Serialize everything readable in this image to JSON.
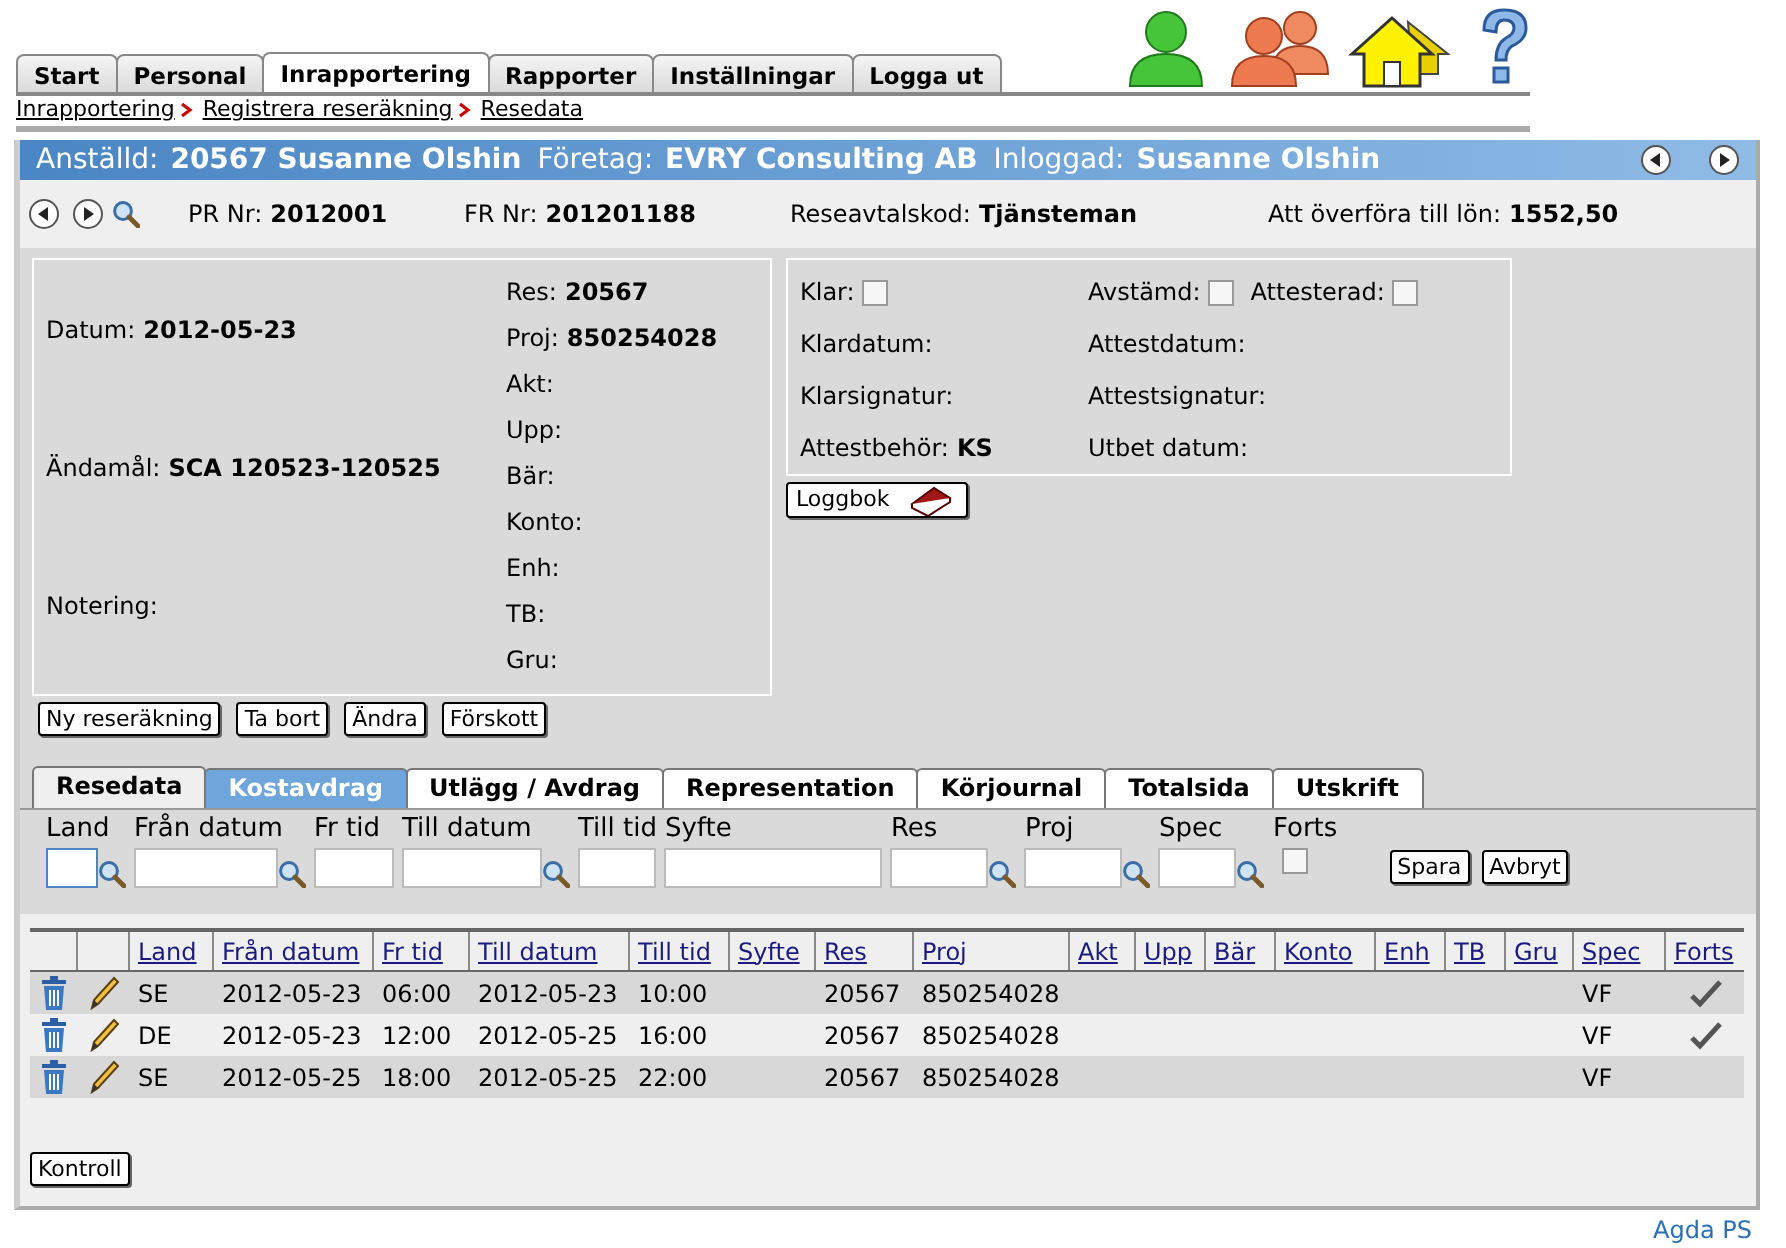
{
  "nav_tabs": [
    {
      "label": "Start",
      "selected": false
    },
    {
      "label": "Personal",
      "selected": false
    },
    {
      "label": "Inrapportering",
      "selected": true
    },
    {
      "label": "Rapporter",
      "selected": false
    },
    {
      "label": "Inställningar",
      "selected": false
    },
    {
      "label": "Logga ut",
      "selected": false
    }
  ],
  "breadcrumb": [
    "Inrapportering",
    "Registrera reseräkning",
    "Resedata"
  ],
  "header": {
    "employee_label": "Anställd:",
    "employee": "20567 Susanne Olshin",
    "company_label": "Företag:",
    "company": "EVRY Consulting AB",
    "login_label": "Inloggad:",
    "login": "Susanne Olshin"
  },
  "info": [
    {
      "label": "PR Nr:",
      "value": "2012001"
    },
    {
      "label": "FR Nr:",
      "value": "201201188"
    },
    {
      "label": "Reseavtalskod:",
      "value": "Tjänsteman"
    },
    {
      "label": "Att överföra till lön:",
      "value": "1552,50"
    }
  ],
  "travel": [
    {
      "label": "Datum:",
      "value": "2012-05-23"
    },
    {
      "label": "Ändamål:",
      "value": "SCA 120523-120525"
    },
    {
      "label": "Notering:"
    }
  ],
  "coding": [
    {
      "label": "Res:",
      "value": "20567"
    },
    {
      "label": "Proj:",
      "value": "850254028"
    },
    {
      "label": "Akt:"
    },
    {
      "label": "Upp:"
    },
    {
      "label": "Bär:"
    },
    {
      "label": "Konto:"
    },
    {
      "label": "Enh:"
    },
    {
      "label": "TB:"
    },
    {
      "label": "Gru:"
    }
  ],
  "approval_rows": [
    {
      "left": [
        {
          "kind": "checkbox",
          "label": "Klar:",
          "checked": false
        }
      ],
      "right": [
        {
          "kind": "checkbox",
          "label": "Avstämd:",
          "checked": false
        },
        {
          "kind": "checkbox",
          "label": "Attesterad:",
          "checked": false
        }
      ]
    },
    {
      "left": [
        {
          "kind": "field",
          "label": "Klardatum:"
        }
      ],
      "right": [
        {
          "kind": "field",
          "label": "Attestdatum:"
        }
      ]
    },
    {
      "left": [
        {
          "kind": "field",
          "label": "Klarsignatur:"
        }
      ],
      "right": [
        {
          "kind": "field",
          "label": "Attestsignatur:"
        }
      ]
    },
    {
      "left": [
        {
          "kind": "field",
          "label": "Attestbehör:",
          "value": "KS"
        }
      ],
      "right": [
        {
          "kind": "field",
          "label": "Utbet datum:"
        }
      ]
    }
  ],
  "logbook_button": "Loggbok",
  "actions": [
    "Ny reseräkning",
    "Ta bort",
    "Ändra",
    "Förskott"
  ],
  "sub_tabs": [
    {
      "label": "Resedata",
      "selected": true,
      "highlighted": false
    },
    {
      "label": "Kostavdrag",
      "selected": false,
      "highlighted": true
    },
    {
      "label": "Utlägg / Avdrag",
      "selected": false,
      "highlighted": false
    },
    {
      "label": "Representation",
      "selected": false,
      "highlighted": false
    },
    {
      "label": "Körjournal",
      "selected": false,
      "highlighted": false
    },
    {
      "label": "Totalsida",
      "selected": false,
      "highlighted": false
    },
    {
      "label": "Utskrift",
      "selected": false,
      "highlighted": false
    }
  ],
  "filters": [
    {
      "label": "Land",
      "kind": "lookup",
      "focused": true
    },
    {
      "label": "Från datum",
      "kind": "lookup",
      "focused": false
    },
    {
      "label": "Fr tid",
      "kind": "input",
      "focused": false
    },
    {
      "label": "Till datum",
      "kind": "lookup",
      "focused": false
    },
    {
      "label": "Till tid",
      "kind": "input",
      "focused": false
    },
    {
      "label": "Syfte",
      "kind": "input",
      "focused": false
    },
    {
      "label": "Res",
      "kind": "lookup",
      "focused": false
    },
    {
      "label": "Proj",
      "kind": "lookup",
      "focused": false
    },
    {
      "label": "Spec",
      "kind": "lookup",
      "focused": false
    },
    {
      "label": "Forts",
      "kind": "checkbox",
      "checked": false
    }
  ],
  "filter_buttons": [
    "Spara",
    "Avbryt"
  ],
  "table": {
    "columns": [
      "Land",
      "Från datum",
      "Fr tid",
      "Till datum",
      "Till tid",
      "Syfte",
      "Res",
      "Proj",
      "Akt",
      "Upp",
      "Bär",
      "Konto",
      "Enh",
      "TB",
      "Gru",
      "Spec",
      "Forts"
    ],
    "rows": [
      {
        "cells": [
          "SE",
          "2012-05-23",
          "06:00",
          "2012-05-23",
          "10:00",
          "",
          "20567",
          "850254028",
          "",
          "",
          "",
          "",
          "",
          "",
          "",
          "VF"
        ],
        "forts": true
      },
      {
        "cells": [
          "DE",
          "2012-05-23",
          "12:00",
          "2012-05-25",
          "16:00",
          "",
          "20567",
          "850254028",
          "",
          "",
          "",
          "",
          "",
          "",
          "",
          "VF"
        ],
        "forts": true
      },
      {
        "cells": [
          "SE",
          "2012-05-25",
          "18:00",
          "2012-05-25",
          "22:00",
          "",
          "20567",
          "850254028",
          "",
          "",
          "",
          "",
          "",
          "",
          "",
          "VF"
        ],
        "forts": false
      }
    ]
  },
  "check_button": "Kontroll",
  "footer_link": "Agda PS"
}
